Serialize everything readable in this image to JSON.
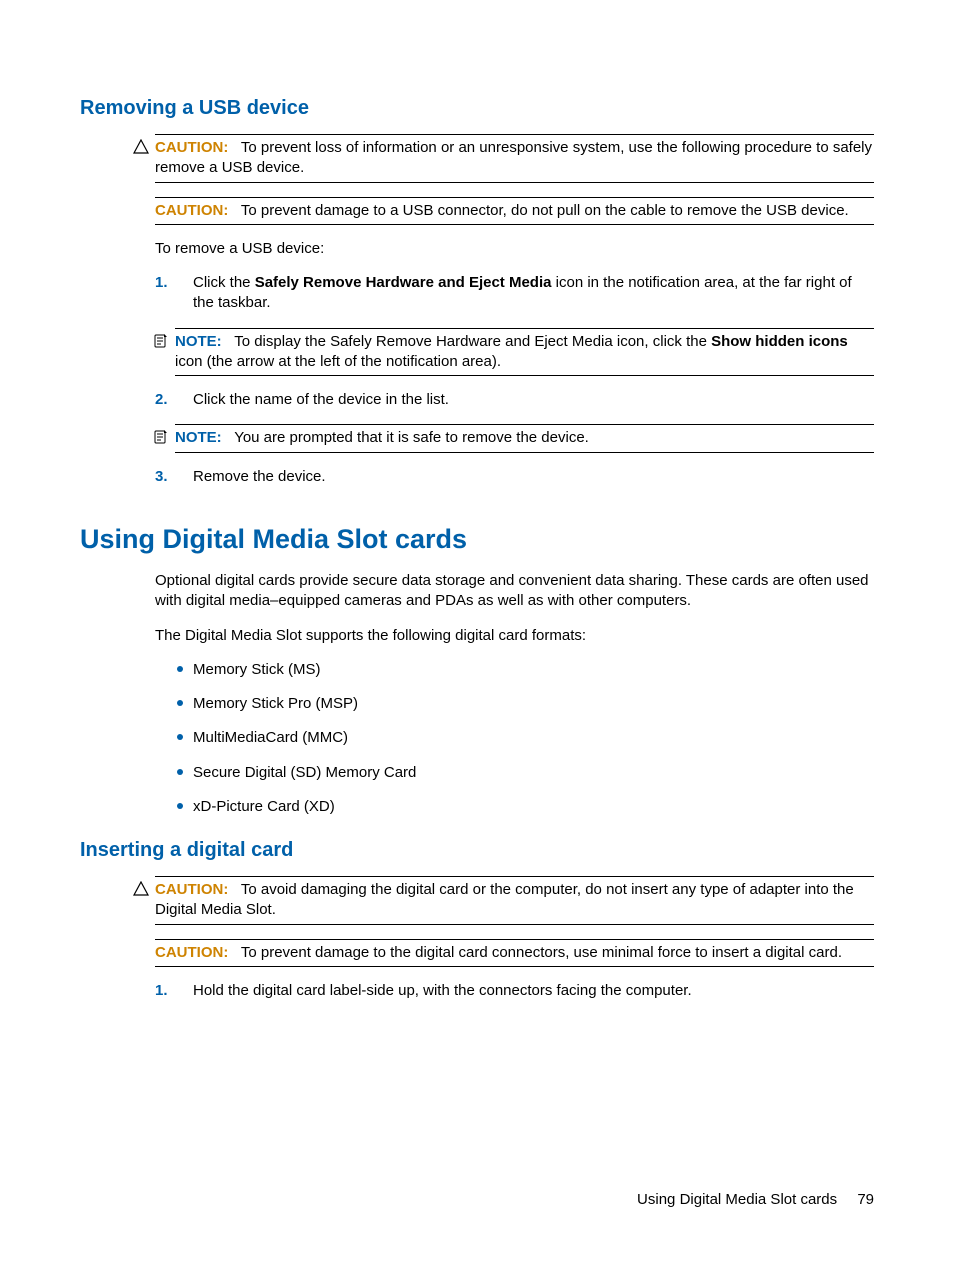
{
  "section1": {
    "heading": "Removing a USB device",
    "caution1": {
      "label": "CAUTION:",
      "text_a": "To prevent loss of information or an unresponsive system, use the following procedure to",
      "text_b": "safely remove a USB device."
    },
    "caution2": {
      "label": "CAUTION:",
      "text": "To prevent damage to a USB connector, do not pull on the cable to remove the USB device."
    },
    "intro": "To remove a USB device:",
    "steps": [
      {
        "num": "1.",
        "text_a": "Click the ",
        "bold_a": "Safely Remove Hardware and Eject Media",
        "text_b": " icon in the notification area, at the far right of the taskbar."
      },
      {
        "num": "2.",
        "text": "Click the name of the device in the list."
      },
      {
        "num": "3.",
        "text": "Remove the device."
      }
    ],
    "note1": {
      "label": "NOTE:",
      "text_a": "To display the Safely Remove Hardware and Eject Media icon, click the ",
      "bold_a": "Show hidden icons",
      "text_b": " icon (the arrow at the left of the notification area)."
    },
    "note2": {
      "label": "NOTE:",
      "text": "You are prompted that it is safe to remove the device."
    }
  },
  "section2": {
    "heading": "Using Digital Media Slot cards",
    "para1": "Optional digital cards provide secure data storage and convenient data sharing. These cards are often used with digital media–equipped cameras and PDAs as well as with other computers.",
    "para2": "The Digital Media Slot supports the following digital card formats:",
    "bullets": [
      "Memory Stick (MS)",
      "Memory Stick Pro (MSP)",
      "MultiMediaCard (MMC)",
      "Secure Digital (SD) Memory Card",
      "xD-Picture Card (XD)"
    ]
  },
  "section3": {
    "heading": "Inserting a digital card",
    "caution1": {
      "label": "CAUTION:",
      "text_a": "To avoid damaging the digital card or the computer, do not insert any type of adapter into",
      "text_b": "the Digital Media Slot."
    },
    "caution2": {
      "label": "CAUTION:",
      "text": "To prevent damage to the digital card connectors, use minimal force to insert a digital card."
    },
    "steps": [
      {
        "num": "1.",
        "text": "Hold the digital card label-side up, with the connectors facing the computer."
      }
    ]
  },
  "footer": {
    "title": "Using Digital Media Slot cards",
    "page": "79"
  }
}
